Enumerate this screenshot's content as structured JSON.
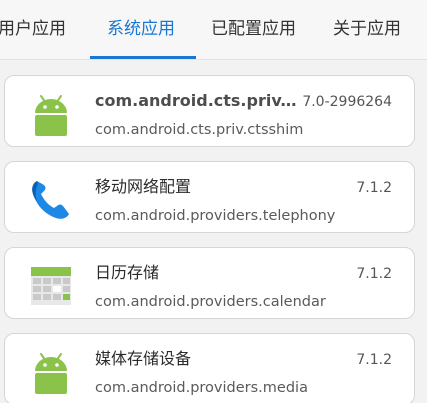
{
  "tabs": [
    {
      "label": "用户应用",
      "active": false
    },
    {
      "label": "系统应用",
      "active": true
    },
    {
      "label": "已配置应用",
      "active": false
    },
    {
      "label": "关于应用",
      "active": false
    }
  ],
  "colors": {
    "accent": "#1976d2",
    "android_green": "#8bc34a",
    "phone_blue": "#1e88e5"
  },
  "apps": [
    {
      "title": "com.android.cts.priv.ctsshim",
      "version": "7.0-2996264",
      "package": "com.android.cts.priv.ctsshim",
      "icon": "android-robot-icon"
    },
    {
      "title": "移动网络配置",
      "version": "7.1.2",
      "package": "com.android.providers.telephony",
      "icon": "phone-handset-icon"
    },
    {
      "title": "日历存储",
      "version": "7.1.2",
      "package": "com.android.providers.calendar",
      "icon": "calendar-icon"
    },
    {
      "title": "媒体存储设备",
      "version": "7.1.2",
      "package": "com.android.providers.media",
      "icon": "android-robot-icon"
    }
  ]
}
